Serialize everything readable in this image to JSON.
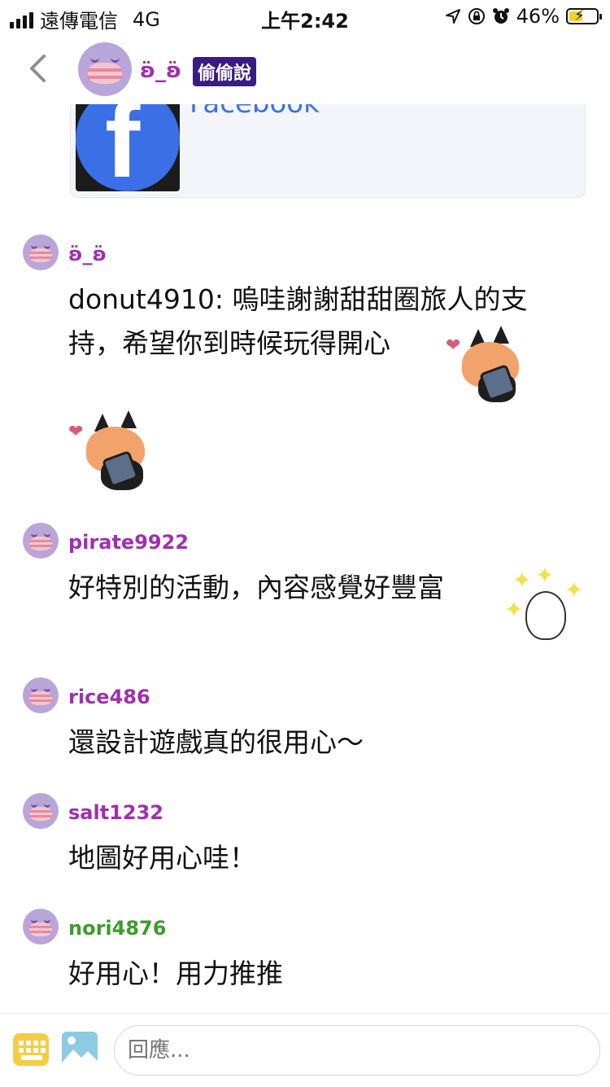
{
  "status_bar": {
    "carrier": "遠傳電信",
    "network": "4G",
    "time": "上午2:42",
    "battery": "46%"
  },
  "header": {
    "name": "ʚ̈_ʚ̈",
    "badge": "偷偷說"
  },
  "link_card": {
    "title": "Facebook"
  },
  "comments": [
    {
      "name": "ʚ̈_ʚ̈",
      "color": "#a02fb0",
      "lines": [
        "donut4910: 嗚哇謝謝甜甜圈旅人的支",
        "持，希望你到時候玩得開心"
      ]
    },
    {
      "name": "pirate9922",
      "color": "#a02fb0",
      "lines": [
        "好特別的活動，內容感覺好豐富"
      ]
    },
    {
      "name": "rice486",
      "color": "#a02fb0",
      "lines": [
        "還設計遊戲真的很用心～"
      ]
    },
    {
      "name": "salt1232",
      "color": "#a02fb0",
      "lines": [
        "地圖好用心哇！"
      ]
    },
    {
      "name": "nori4876",
      "color": "#3f9b2c",
      "lines": [
        "好用心！用力推推"
      ]
    }
  ],
  "reply_box": {
    "placeholder": "回應..."
  },
  "icons": {
    "back": "chevron-left-icon",
    "keyboard": "keyboard-icon",
    "image": "image-icon",
    "location": "location-arrow-icon",
    "lock": "rotation-lock-icon",
    "alarm": "alarm-icon",
    "battery": "battery-charging-icon"
  }
}
